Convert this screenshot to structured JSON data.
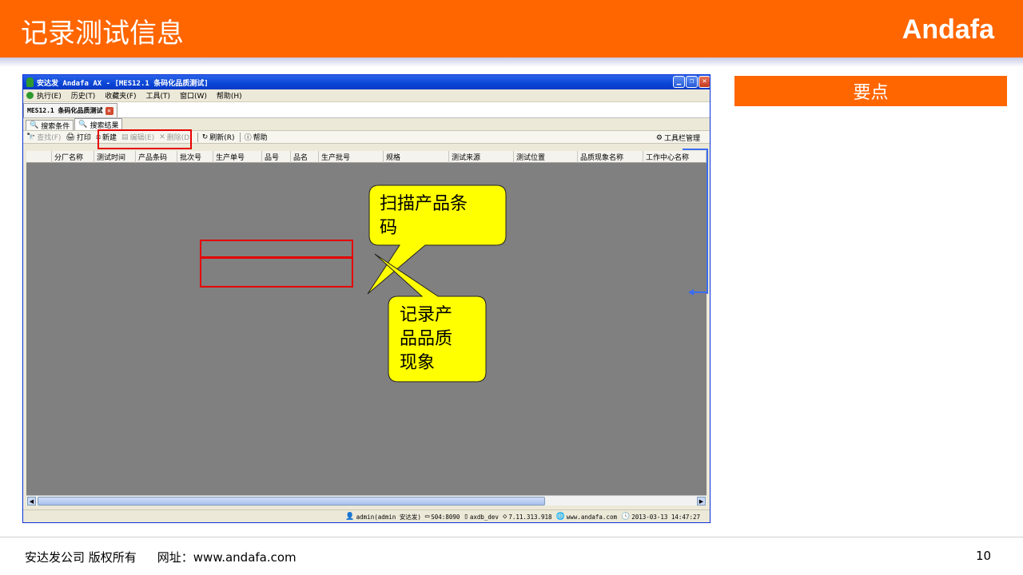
{
  "slide": {
    "title": "记录测试信息",
    "brand": "Andafa",
    "keypoints_header": "要点",
    "footer": {
      "copyright": "安达发公司 版权所有",
      "website": "网址：www.andafa.com",
      "page": "10"
    }
  },
  "app": {
    "window_title": "安达发 Andafa AX - [MES12.1 条码化品质测试]",
    "menu": [
      "执行(E)",
      "历史(T)",
      "收藏夹(F)",
      "工具(T)",
      "窗口(W)",
      "帮助(H)"
    ],
    "doc_tab": "MES12.1 条码化品质测试",
    "sub_tabs": [
      "搜索条件",
      "搜索结果"
    ],
    "toolbar": {
      "search": "查找(F)",
      "print": "打印",
      "new": "新建",
      "edit": "编辑(E)",
      "delete": "删除(D)",
      "refresh": "刷新(R)",
      "help": "帮助",
      "toolbar_manage": "工具栏管理"
    },
    "columns": [
      "分厂名称",
      "测试时间",
      "产品条码",
      "批次号",
      "生产单号",
      "品号",
      "品名",
      "生产批号",
      "规格",
      "测试来源",
      "测试位置",
      "品质现象名称",
      "工作中心名称"
    ],
    "status": {
      "user": "admin(admin 安达发)",
      "server": "S04:8090",
      "db": "axdb_dev",
      "version": "7.11.313.918",
      "site": "www.andafa.com",
      "datetime": "2013-03-13 14:47:27"
    },
    "icons": {
      "app": "app-icon",
      "run": "run-icon",
      "search": "search-icon",
      "print": "printer-icon",
      "new": "new-icon",
      "edit": "edit-icon",
      "delete": "delete-icon",
      "refresh": "refresh-icon",
      "help": "help-icon",
      "settings": "toolbar-manage-icon"
    }
  },
  "callouts": {
    "scan": [
      "扫描产品条",
      "码"
    ],
    "record": [
      "记录产",
      "品品质",
      "现象"
    ]
  },
  "colors": {
    "accent": "#ff6600",
    "highlight": "#e60000",
    "callout": "#ffff00",
    "bracket": "#3a6df0",
    "grid": "#808080"
  }
}
